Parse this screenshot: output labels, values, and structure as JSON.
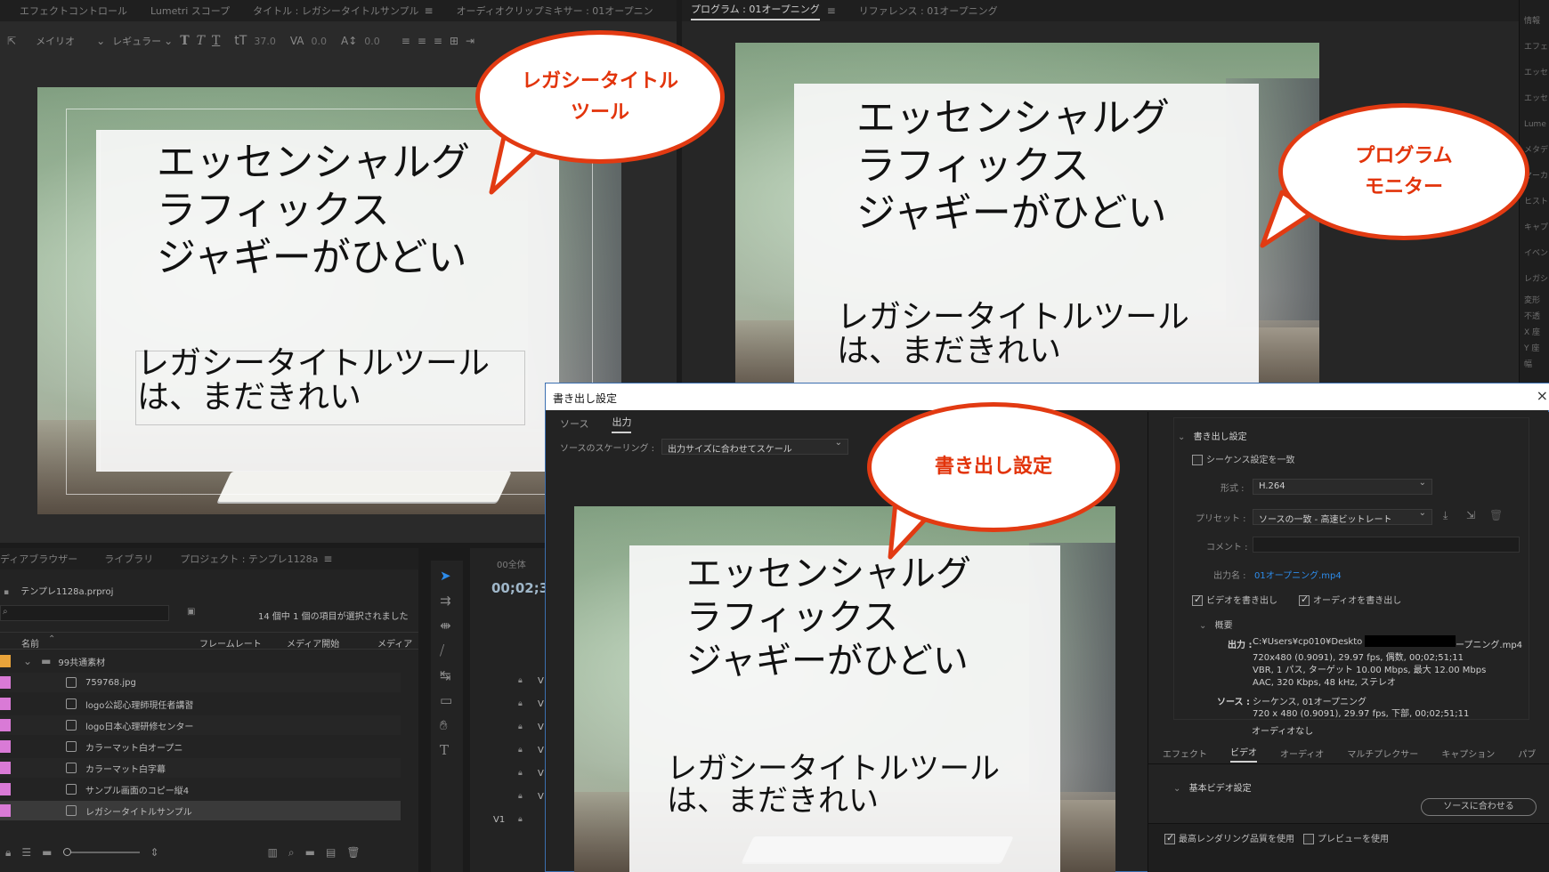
{
  "left_top_tabs": [
    "エフェクトコントロール",
    "Lumetri スコープ",
    "タイトル : レガシータイトルサンプル",
    "オーディオクリップミキサー : 01オープニン"
  ],
  "title_toolbar": {
    "font": "メイリオ",
    "style": "レギュラー",
    "size": "37.0",
    "kerning": "0.0",
    "leading": "0.0"
  },
  "title_canvas": {
    "line1": "エッセンシャルグ",
    "line2": "ラフィックス",
    "line3": "ジャギーがひどい",
    "sub1": "レガシータイトルツール",
    "sub2": "は、まだきれい"
  },
  "program_tabs": [
    "プログラム : 01オープニング",
    "リファレンス : 01オープニング"
  ],
  "program_canvas": {
    "line1": "エッセンシャルグ",
    "line2": "ラフィックス",
    "line3": "ジャギーがひどい",
    "sub1": "レガシータイトルツール",
    "sub2": "は、まだきれい"
  },
  "right_edge_items": [
    "情報",
    "エフェ",
    "エッセ",
    "エッセ",
    "Lume",
    "メタデ",
    "マーカ",
    "ヒスト",
    "キャプ",
    "イベン",
    "レガシ",
    "変形",
    "不透",
    "X 座",
    "Y 座",
    "幅"
  ],
  "project_panel": {
    "tabs": [
      "ディアブラウザー",
      "ライブラリ",
      "プロジェクト : テンプレ1128a"
    ],
    "file": "テンプレ1128a.prproj",
    "selection": "14 個中 1 個の項目が選択されました",
    "columns": [
      "名前",
      "フレームレート",
      "メディア開始",
      "メディア"
    ],
    "folder": "99共通素材",
    "items": [
      "759768.jpg",
      "logo公認心理師現任者講習",
      "logo日本心理研修センター",
      "カラーマット白オープニ",
      "カラーマット白字幕",
      "サンプル画面のコピー縦4",
      "レガシータイトルサンプル"
    ],
    "swatch_colors": [
      "#e8a33a",
      "#d97ad6",
      "#d97ad6",
      "#d97ad6",
      "#d97ad6",
      "#d97ad6",
      "#d97ad6",
      "#d97ad6"
    ]
  },
  "timeline": {
    "tab": "00全体",
    "timecode": "00;02;3",
    "tracks": [
      "V",
      "V",
      "V",
      "V",
      "V",
      "V",
      "V1"
    ]
  },
  "export_dialog": {
    "title": "書き出し設定",
    "tabs": [
      "ソース",
      "出力"
    ],
    "scaling_label": "ソースのスケーリング :",
    "scaling_value": "出力サイズに合わせてスケール",
    "preview": {
      "line1": "エッセンシャルグ",
      "line2": "ラフィックス",
      "line3": "ジャギーがひどい",
      "sub1": "レガシータイトルツール",
      "sub2": "は、まだきれい"
    },
    "settings_header": "書き出し設定",
    "match_sequence": "シーケンス設定を一致",
    "format_label": "形式 :",
    "format_value": "H.264",
    "preset_label": "プリセット :",
    "preset_value": "ソースの一致 - 高速ビットレート",
    "comment_label": "コメント :",
    "output_name_label": "出力名 :",
    "output_name_value": "01オープニング.mp4",
    "export_video": "ビデオを書き出し",
    "export_audio": "オーディオを書き出し",
    "summary_header": "概要",
    "output_label": "出力 :",
    "output_path_start": "C:¥Users¥cp010¥Deskto",
    "output_path_end": "ープニング.mp4",
    "output_lines": [
      "720x480 (0.9091), 29.97 fps, 偶数, 00;02;51;11",
      "VBR, 1 パス, ターゲット 10.00 Mbps, 最大 12.00 Mbps",
      "AAC, 320 Kbps, 48 kHz, ステレオ"
    ],
    "source_label": "ソース :",
    "source_lines": [
      "シーケンス, 01オープニング",
      "720 x 480 (0.9091), 29.97 fps, 下部, 00;02;51;11",
      "オーディオなし"
    ],
    "bottom_tabs": [
      "エフェクト",
      "ビデオ",
      "オーディオ",
      "マルチプレクサー",
      "キャプション",
      "パブ"
    ],
    "basic_video": "基本ビデオ設定",
    "match_source_btn": "ソースに合わせる",
    "max_render": "最高レンダリング品質を使用",
    "use_preview": "プレビューを使用",
    "close": "×"
  },
  "callouts": {
    "legacy_line1": "レガシータイトル",
    "legacy_line2": "ツール",
    "program_line1": "プログラム",
    "program_line2": "モニター",
    "export": "書き出し設定"
  },
  "colors": {
    "callout_red": "#e23a12",
    "accent_blue": "#2d8ceb"
  }
}
